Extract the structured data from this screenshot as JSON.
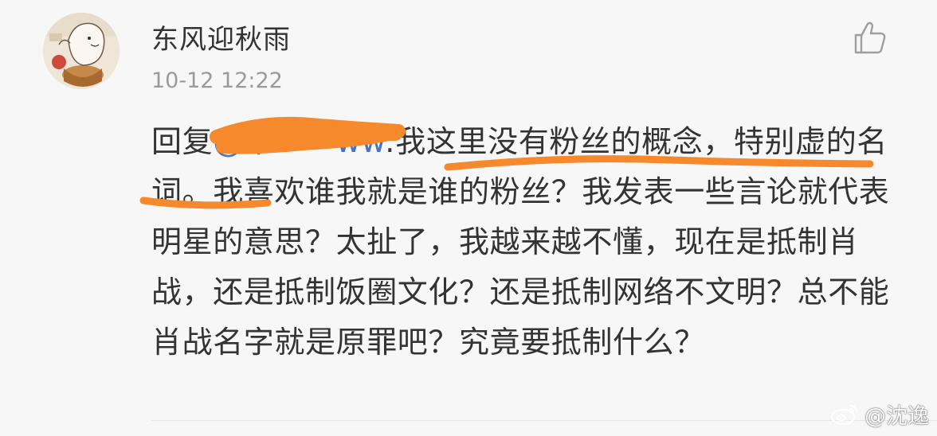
{
  "comment": {
    "username": "东风迎秋雨",
    "timestamp": "10-12 12:22",
    "reply_prefix": "回复",
    "mention": "@米一一ww",
    "text": ":我这里没有粉丝的概念，特别虚的名词。我喜欢谁我就是谁的粉丝？我发表一些言论就代表明星的意思？太扯了，我越来越不懂，现在是抵制肖战，还是抵制饭圈文化？还是抵制网络不文明？总不能肖战名字就是原罪吧？究竟要抵制什么？"
  },
  "watermark": {
    "label": "@沈逸",
    "icon": "weibo-logo-icon"
  },
  "colors": {
    "background": "#f7f7f7",
    "text": "#333333",
    "timestamp": "#9a9a9a",
    "mention": "#4a74c0",
    "highlight": "#f5892b"
  }
}
